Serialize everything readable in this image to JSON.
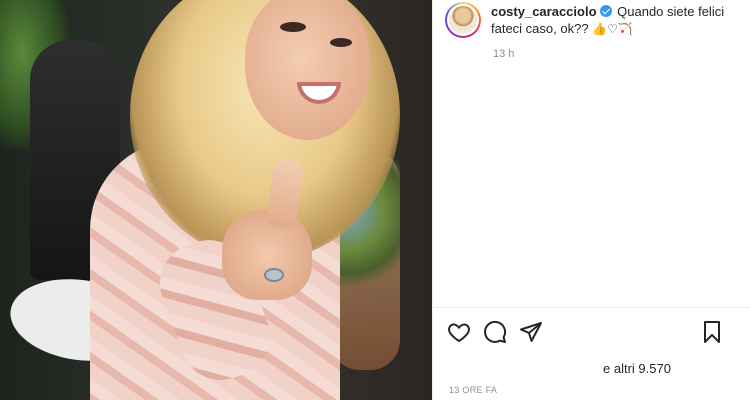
{
  "post": {
    "username": "costy_caracciolo",
    "caption_line1": "Quando siete felici",
    "caption_line2": "fateci caso, ok??",
    "caption_emojis": "👍♡🏹",
    "time_ago": "13 h",
    "likes": "e altri 9.570",
    "date": "13 ORE FA"
  },
  "icons": {
    "like": "heart-icon",
    "comment": "comment-icon",
    "share": "share-icon",
    "save": "bookmark-icon",
    "verified": "verified-badge-icon"
  },
  "colors": {
    "verified": "#3897f0",
    "text": "#262626",
    "muted": "#8e8e8e"
  }
}
